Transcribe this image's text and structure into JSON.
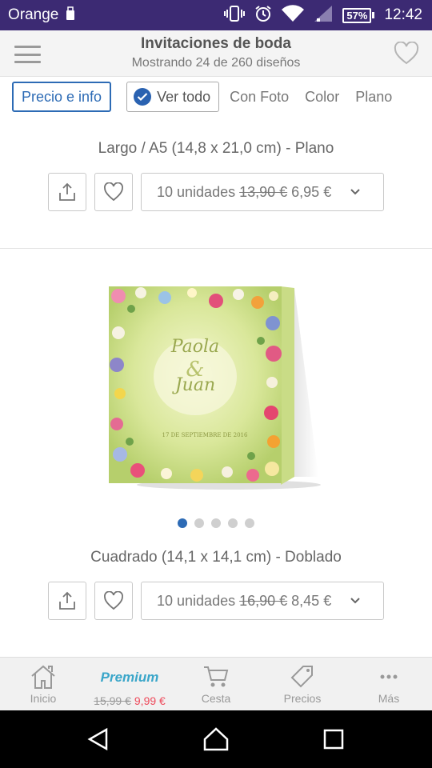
{
  "status": {
    "carrier": "Orange",
    "battery": "57%",
    "time": "12:42"
  },
  "header": {
    "title": "Invitaciones de boda",
    "subtitle": "Mostrando 24 de 260 diseños"
  },
  "filters": {
    "price_info": "Precio e info",
    "view_all": "Ver todo",
    "links": [
      "Con Foto",
      "Color",
      "Plano"
    ]
  },
  "products": [
    {
      "title": "Largo / A5 (14,8 x 21,0 cm) - Plano",
      "quantity": "10 unidades",
      "old_price": "13,90 €",
      "new_price": "6,95 €"
    },
    {
      "title": "Cuadrado (14,1 x 14,1 cm) - Doblado",
      "quantity": "10 unidades",
      "old_price": "16,90 €",
      "new_price": "8,45 €",
      "card": {
        "name1": "Paola",
        "ampersand": "&",
        "name2": "Juan",
        "date": "17 DE SEPTIEMBRE DE 2016"
      },
      "carousel_dots": 5,
      "carousel_active": 1
    }
  ],
  "tabs": {
    "inicio": "Inicio",
    "premium": "Premium",
    "premium_old": "15,99 €",
    "premium_new": "9,99 €",
    "cesta": "Cesta",
    "precios": "Precios",
    "mas": "Más"
  },
  "colors": {
    "status_bar": "#3c2a73",
    "accent": "#2d6bb5",
    "premium": "#3aa6c9",
    "sale": "#ee4a5b"
  }
}
